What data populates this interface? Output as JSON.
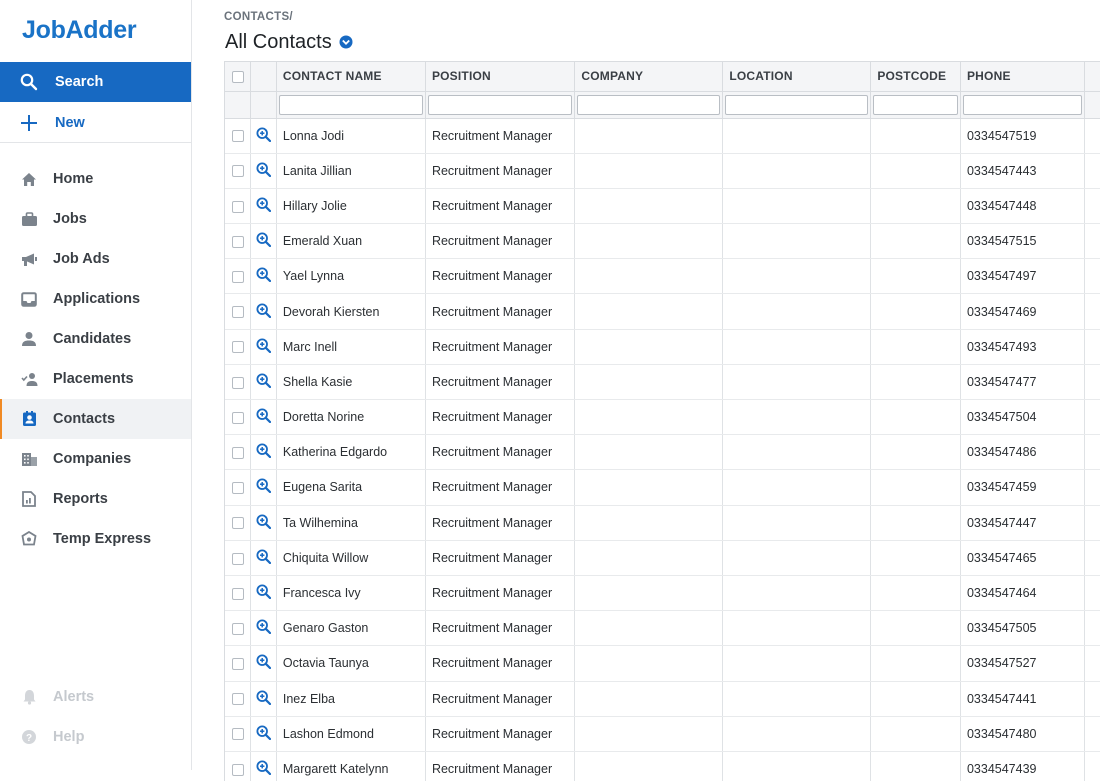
{
  "brand": {
    "logo_text": "JobAdder"
  },
  "sidebar": {
    "search_label": "Search",
    "new_label": "New",
    "items": [
      {
        "label": "Home",
        "icon": "home-icon"
      },
      {
        "label": "Jobs",
        "icon": "briefcase-icon"
      },
      {
        "label": "Job Ads",
        "icon": "megaphone-icon"
      },
      {
        "label": "Applications",
        "icon": "inbox-icon"
      },
      {
        "label": "Candidates",
        "icon": "person-icon"
      },
      {
        "label": "Placements",
        "icon": "person-check-icon"
      },
      {
        "label": "Contacts",
        "icon": "contact-card-icon",
        "active": true
      },
      {
        "label": "Companies",
        "icon": "building-icon"
      },
      {
        "label": "Reports",
        "icon": "report-icon"
      },
      {
        "label": "Temp Express",
        "icon": "temp-express-icon"
      }
    ],
    "bottom_items": [
      {
        "label": "Alerts",
        "icon": "bell-icon"
      },
      {
        "label": "Help",
        "icon": "help-icon"
      }
    ]
  },
  "header": {
    "breadcrumb": "CONTACTS/",
    "title": "All Contacts"
  },
  "table": {
    "columns": [
      "CONTACT NAME",
      "POSITION",
      "COMPANY",
      "LOCATION",
      "POSTCODE",
      "PHONE"
    ],
    "rows": [
      {
        "name": "Lonna Jodi",
        "position": "Recruitment Manager",
        "company": "",
        "location": "",
        "postcode": "",
        "phone": "0334547519"
      },
      {
        "name": "Lanita Jillian",
        "position": "Recruitment Manager",
        "company": "",
        "location": "",
        "postcode": "",
        "phone": "0334547443"
      },
      {
        "name": "Hillary Jolie",
        "position": "Recruitment Manager",
        "company": "",
        "location": "",
        "postcode": "",
        "phone": "0334547448"
      },
      {
        "name": "Emerald Xuan",
        "position": "Recruitment Manager",
        "company": "",
        "location": "",
        "postcode": "",
        "phone": "0334547515"
      },
      {
        "name": "Yael Lynna",
        "position": "Recruitment Manager",
        "company": "",
        "location": "",
        "postcode": "",
        "phone": "0334547497"
      },
      {
        "name": "Devorah Kiersten",
        "position": "Recruitment Manager",
        "company": "",
        "location": "",
        "postcode": "",
        "phone": "0334547469"
      },
      {
        "name": "Marc Inell",
        "position": "Recruitment Manager",
        "company": "",
        "location": "",
        "postcode": "",
        "phone": "0334547493"
      },
      {
        "name": "Shella Kasie",
        "position": "Recruitment Manager",
        "company": "",
        "location": "",
        "postcode": "",
        "phone": "0334547477"
      },
      {
        "name": "Doretta Norine",
        "position": "Recruitment Manager",
        "company": "",
        "location": "",
        "postcode": "",
        "phone": "0334547504"
      },
      {
        "name": "Katherina Edgardo",
        "position": "Recruitment Manager",
        "company": "",
        "location": "",
        "postcode": "",
        "phone": "0334547486"
      },
      {
        "name": "Eugena Sarita",
        "position": "Recruitment Manager",
        "company": "",
        "location": "",
        "postcode": "",
        "phone": "0334547459"
      },
      {
        "name": "Ta Wilhemina",
        "position": "Recruitment Manager",
        "company": "",
        "location": "",
        "postcode": "",
        "phone": "0334547447"
      },
      {
        "name": "Chiquita Willow",
        "position": "Recruitment Manager",
        "company": "",
        "location": "",
        "postcode": "",
        "phone": "0334547465"
      },
      {
        "name": "Francesca Ivy",
        "position": "Recruitment Manager",
        "company": "",
        "location": "",
        "postcode": "",
        "phone": "0334547464"
      },
      {
        "name": "Genaro Gaston",
        "position": "Recruitment Manager",
        "company": "",
        "location": "",
        "postcode": "",
        "phone": "0334547505"
      },
      {
        "name": "Octavia Taunya",
        "position": "Recruitment Manager",
        "company": "",
        "location": "",
        "postcode": "",
        "phone": "0334547527"
      },
      {
        "name": "Inez Elba",
        "position": "Recruitment Manager",
        "company": "",
        "location": "",
        "postcode": "",
        "phone": "0334547441"
      },
      {
        "name": "Lashon Edmond",
        "position": "Recruitment Manager",
        "company": "",
        "location": "",
        "postcode": "",
        "phone": "0334547480"
      },
      {
        "name": "Margarett Katelynn",
        "position": "Recruitment Manager",
        "company": "",
        "location": "",
        "postcode": "",
        "phone": "0334547439"
      }
    ]
  },
  "colors": {
    "brand": "#1a73c7",
    "search_bg": "#1769c2",
    "active_accent": "#f08a24"
  }
}
